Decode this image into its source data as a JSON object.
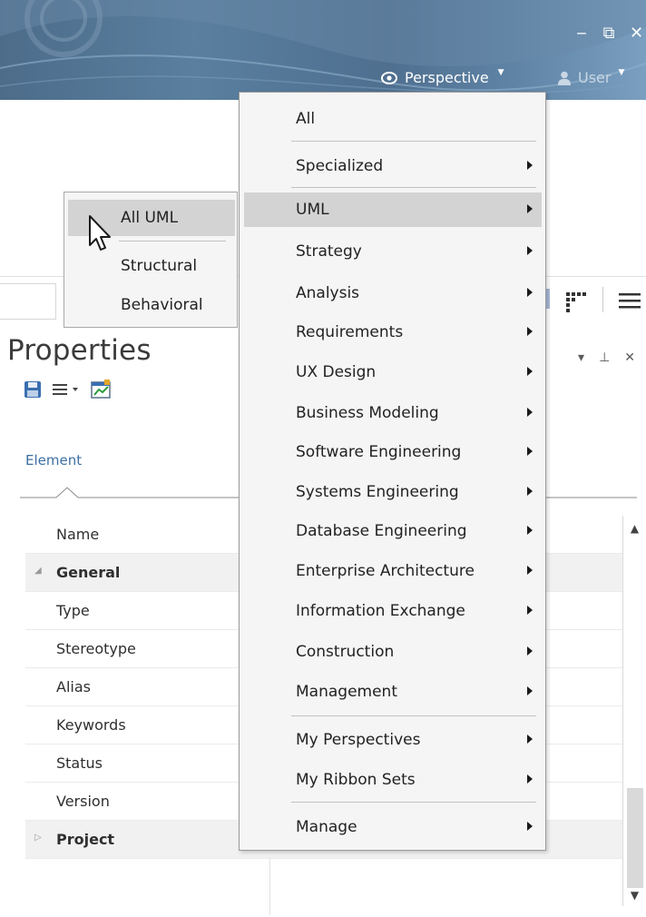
{
  "titlebar": {
    "window_controls": {
      "minimize": "‒",
      "restore": "⧉",
      "close": "✕"
    },
    "perspective_button": {
      "label": "Perspective",
      "icon": "eye-icon"
    },
    "user_button": {
      "label": "User",
      "icon": "user-icon"
    }
  },
  "perspective_menu": {
    "items": [
      {
        "label": "All",
        "has_submenu": false
      },
      {
        "label": "Specialized",
        "has_submenu": true
      },
      {
        "label": "UML",
        "has_submenu": true,
        "highlighted": true
      },
      {
        "label": "Strategy",
        "has_submenu": true
      },
      {
        "label": "Analysis",
        "has_submenu": true
      },
      {
        "label": "Requirements",
        "has_submenu": true
      },
      {
        "label": "UX Design",
        "has_submenu": true
      },
      {
        "label": "Business Modeling",
        "has_submenu": true
      },
      {
        "label": "Software Engineering",
        "has_submenu": true
      },
      {
        "label": "Systems Engineering",
        "has_submenu": true
      },
      {
        "label": "Database Engineering",
        "has_submenu": true
      },
      {
        "label": "Enterprise Architecture",
        "has_submenu": true
      },
      {
        "label": "Information Exchange",
        "has_submenu": true
      },
      {
        "label": "Construction",
        "has_submenu": true
      },
      {
        "label": "Management",
        "has_submenu": true
      },
      {
        "label": "My Perspectives",
        "has_submenu": true
      },
      {
        "label": "My Ribbon Sets",
        "has_submenu": true
      },
      {
        "label": "Manage",
        "has_submenu": true
      }
    ]
  },
  "uml_submenu": {
    "items": [
      {
        "label": "All UML",
        "highlighted": true
      },
      {
        "label": "Structural"
      },
      {
        "label": "Behavioral"
      }
    ]
  },
  "properties": {
    "title": "Properties",
    "tab": "Element",
    "rows": [
      {
        "label": "Name",
        "group": false
      },
      {
        "label": "General",
        "group": true,
        "expanded": true
      },
      {
        "label": "Type",
        "group": false
      },
      {
        "label": "Stereotype",
        "group": false
      },
      {
        "label": "Alias",
        "group": false
      },
      {
        "label": "Keywords",
        "group": false
      },
      {
        "label": "Status",
        "group": false
      },
      {
        "label": "Version",
        "group": false
      },
      {
        "label": "Project",
        "group": true,
        "expanded": false
      }
    ],
    "panel_controls": {
      "dropdown": "▾",
      "pin": "⊥",
      "close": "✕"
    }
  }
}
